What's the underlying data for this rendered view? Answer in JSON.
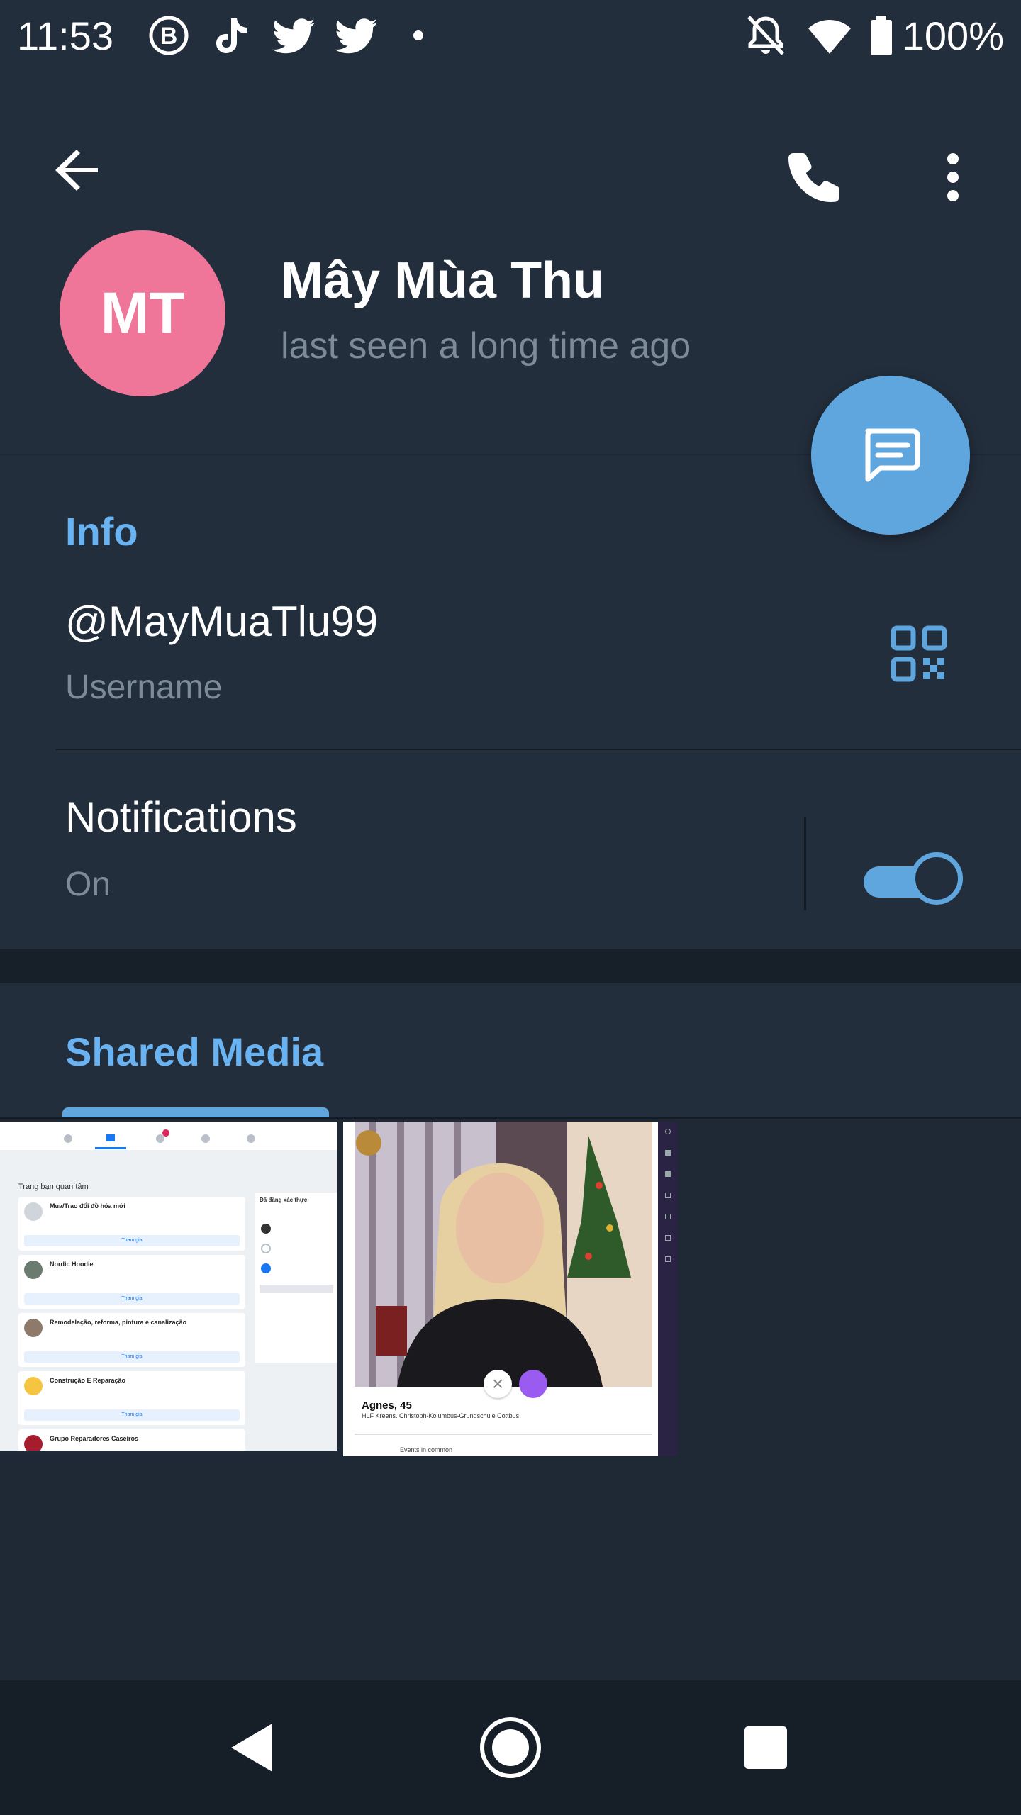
{
  "status_bar": {
    "time": "11:53",
    "battery": "100%",
    "icons": [
      "b-circle-icon",
      "tiktok-icon",
      "twitter-icon",
      "twitter-icon",
      "dot-icon",
      "notifications-off-icon",
      "wifi-icon",
      "battery-icon"
    ]
  },
  "header": {
    "back_icon": "arrow-left-icon",
    "call_icon": "phone-icon",
    "menu_icon": "more-vert-icon",
    "avatar_initials": "MT",
    "avatar_color": "#ef7599",
    "name": "Mây Mùa Thu",
    "status": "last seen a long time ago",
    "fab_icon": "message-icon"
  },
  "info": {
    "title": "Info",
    "username": "@MayMuaTlu99",
    "username_label": "Username",
    "qr_icon": "qr-code-icon",
    "notifications_label": "Notifications",
    "notifications_value": "On",
    "notifications_enabled": true
  },
  "media": {
    "tab_label": "Shared Media",
    "thumb1": {
      "heading": "Trang bạn quan tâm",
      "items": [
        "Mua/Trao đổi đồ hóa mới",
        "Nordic Hoodie",
        "Remodelação, reforma, pintura e canalização",
        "Construção E Reparação",
        "Grupo Reparadores Caseiros"
      ],
      "side_heading": "Đã đăng xác thực",
      "action_label": "Tham gia"
    },
    "thumb2": {
      "name": "Agnes, 45",
      "subtitle": "HLF Kreens. Christoph-Kolumbus-Grundschule Cottbus",
      "footer": "Events in common"
    }
  },
  "colors": {
    "accent": "#6ab3f3",
    "fab": "#5ea6dd",
    "background": "#1c2533",
    "surface": "#232e3c"
  }
}
